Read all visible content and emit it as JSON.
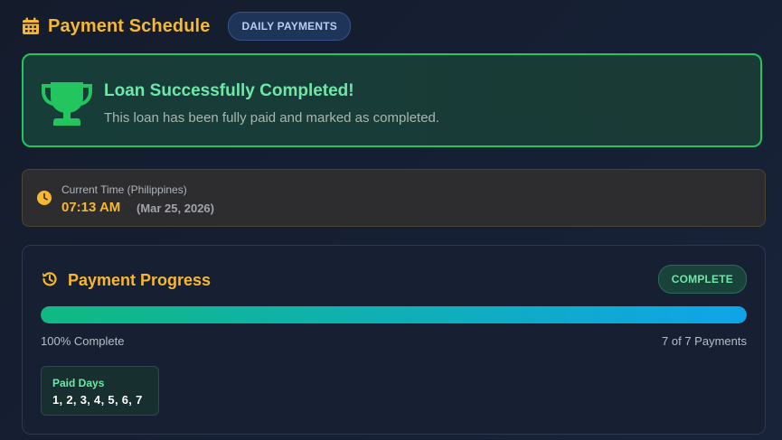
{
  "header": {
    "title": "Payment Schedule",
    "badge": "DAILY PAYMENTS",
    "icon": "calendar-icon"
  },
  "success": {
    "title": "Loan Successfully Completed!",
    "description": "This loan has been fully paid and marked as completed.",
    "icon": "trophy-icon"
  },
  "time": {
    "label": "Current Time (Philippines)",
    "value": "07:13 AM",
    "date": "(Mar 25, 2026)",
    "icon": "clock-icon"
  },
  "progress": {
    "title": "Payment Progress",
    "status_badge": "COMPLETE",
    "percent_label": "100% Complete",
    "count_label": "7 of 7 Payments",
    "fill_fraction": 1.0,
    "icon": "history-icon",
    "paid_days": {
      "label": "Paid Days",
      "values": "1, 2, 3, 4, 5, 6, 7"
    }
  },
  "colors": {
    "accent": "#f7b731",
    "success": "#22c55e",
    "success_text": "#6ee7a8",
    "bar_start": "#10b981",
    "bar_end": "#0ea5e9"
  }
}
